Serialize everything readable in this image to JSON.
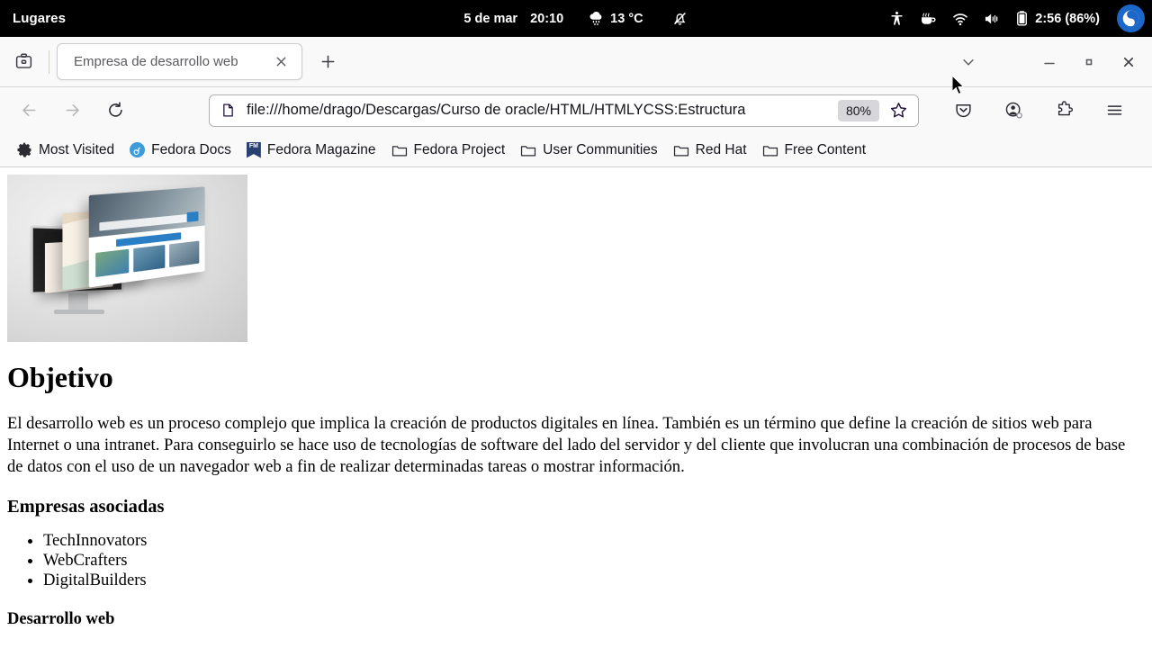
{
  "system_bar": {
    "places_label": "Lugares",
    "date": "5 de mar",
    "time": "20:10",
    "weather_icon": "rain-cloud-icon",
    "temperature": "13 °C",
    "notifications_icon": "bell-muted-icon",
    "accessibility_icon": "accessibility-icon",
    "coffee_icon": "coffee-cup-icon",
    "wifi_icon": "wifi-icon",
    "volume_icon": "volume-icon",
    "battery_icon": "battery-icon",
    "battery_label": "2:56 (86%)",
    "avatar_icon": "user-avatar-icon"
  },
  "browser": {
    "firefox_view_icon": "firefox-view-icon",
    "tab": {
      "title": "Empresa de desarrollo web",
      "close_icon": "close-icon"
    },
    "new_tab_icon": "plus-icon",
    "all_tabs_icon": "chevron-down-icon",
    "window_controls": {
      "minimize_icon": "minimize-icon",
      "maximize_icon": "maximize-icon",
      "close_icon": "close-icon"
    },
    "nav": {
      "back_icon": "arrow-left-icon",
      "forward_icon": "arrow-right-icon",
      "reload_icon": "reload-icon"
    },
    "urlbar": {
      "page_icon": "document-icon",
      "url": "file:///home/drago/Descargas/Curso de oracle/HTML/HTMLYCSS:Estructura",
      "zoom_level": "80%",
      "bookmark_icon": "star-icon"
    },
    "toolbar_right": {
      "pocket_icon": "pocket-icon",
      "account_icon": "account-icon",
      "extensions_icon": "puzzle-piece-icon",
      "menu_icon": "hamburger-menu-icon"
    },
    "bookmarks": [
      {
        "label": "Most Visited",
        "icon": "gear-icon"
      },
      {
        "label": "Fedora Docs",
        "icon": "fedora-icon"
      },
      {
        "label": "Fedora Magazine",
        "icon": "fedora-magazine-icon"
      },
      {
        "label": "Fedora Project",
        "icon": "folder-icon"
      },
      {
        "label": "User Communities",
        "icon": "folder-icon"
      },
      {
        "label": "Red Hat",
        "icon": "folder-icon"
      },
      {
        "label": "Free Content",
        "icon": "folder-icon"
      }
    ]
  },
  "page": {
    "hero_image_alt": "web-development-monitor-image",
    "heading": "Objetivo",
    "paragraph": "El desarrollo web es un proceso complejo que implica la creación de productos digitales en línea. También es un término que define la creación de sitios web para Internet o una intranet. Para conseguirlo se hace uso de tecnologías de software del lado del servidor y del cliente que involucran una combinación de procesos de base de datos con el uso de un navegador web a fin de realizar determinadas tareas o mostrar información.",
    "subheading_companies": "Empresas asociadas",
    "companies": [
      "TechInnovators",
      "WebCrafters",
      "DigitalBuilders"
    ],
    "subheading_dev": "Desarrollo web"
  },
  "colors": {
    "topbar_bg": "#000000",
    "chrome_bg": "#f9f9fa",
    "accent_blue": "#1d67c8",
    "zoom_badge_bg": "#d7d7db"
  }
}
